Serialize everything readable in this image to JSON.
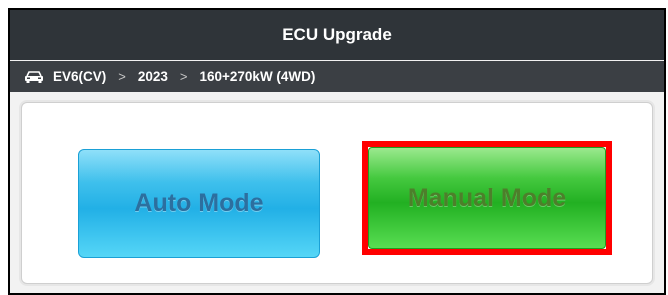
{
  "window": {
    "title": "ECU Upgrade"
  },
  "breadcrumb": {
    "icon": "car-icon",
    "items": [
      "EV6(CV)",
      "2023",
      "160+270kW (4WD)"
    ],
    "separator": ">"
  },
  "modes": {
    "auto_label": "Auto Mode",
    "manual_label": "Manual Mode"
  },
  "colors": {
    "titlebar": "#2f3439",
    "auto_button": "#22b0e6",
    "manual_button": "#22b022",
    "highlight": "#ff0000"
  }
}
